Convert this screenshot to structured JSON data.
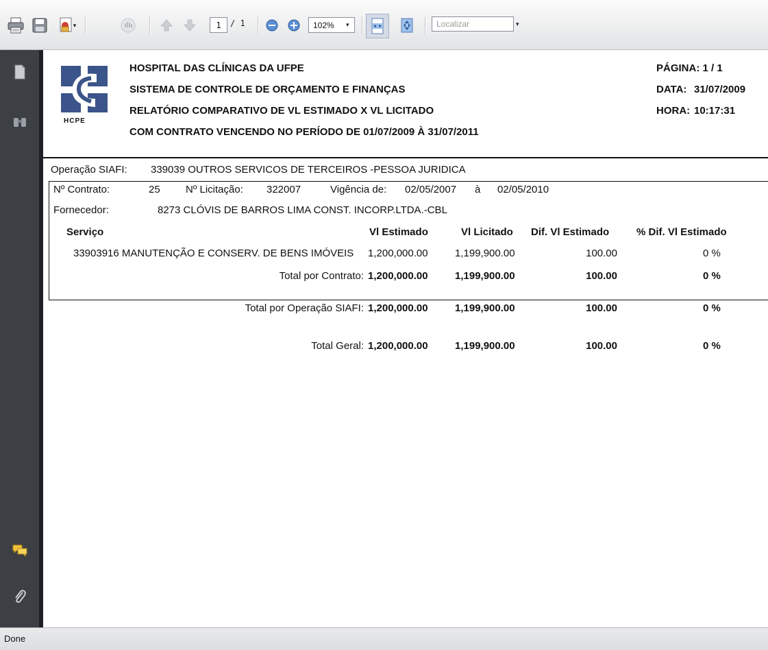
{
  "toolbar": {
    "icons": [
      "printer-icon",
      "save-icon",
      "email-icon",
      "hand-icon",
      "previous-page-icon",
      "next-page-icon",
      "zoom-out-icon",
      "zoom-in-icon",
      "fit-width-icon",
      "fit-page-icon"
    ],
    "page_current": "1",
    "page_total": "/ 1",
    "zoom": "102%",
    "find_placeholder": "Localizar"
  },
  "sidebar": {
    "icons": [
      "pages-icon",
      "search-icon",
      "comments-icon",
      "attachments-icon"
    ]
  },
  "report": {
    "logo_text": "HCPE",
    "header_lines": [
      "HOSPITAL DAS CLÍNICAS DA UFPE",
      "SISTEMA DE CONTROLE DE ORÇAMENTO E FINANÇAS",
      "RELATÓRIO COMPARATIVO DE VL ESTIMADO X VL LICITADO",
      "COM CONTRATO VENCENDO NO PERÍODO DE 01/07/2009 À 31/07/2011"
    ],
    "page_label": "PÁGINA: 1 / 1",
    "date_label": "DATA:",
    "date_value": "31/07/2009",
    "time_label": "HORA:",
    "time_value": "10:17:31",
    "operacao_label": "Operação SIAFI:",
    "operacao_value": "339039  OUTROS SERVICOS DE TERCEIROS -PESSOA JURIDICA",
    "contrato_label": "Nº Contrato:",
    "contrato_value": "25",
    "licitacao_label": "Nº Licitação:",
    "licitacao_value": "322007",
    "vigencia_label": "Vigência de:",
    "vigencia_start": "02/05/2007",
    "vigencia_sep": "à",
    "vigencia_end": "02/05/2010",
    "fornecedor_label": "Fornecedor:",
    "fornecedor_value": "8273  CLÓVIS DE BARROS LIMA CONST. INCORP.LTDA.-CBL",
    "columns": [
      "Serviço",
      "Vl Estimado",
      "Vl Licitado",
      "Dif. Vl Estimado",
      "% Dif. Vl Estimado"
    ],
    "row": {
      "servico": "33903916  MANUTENÇÃO E CONSERV. DE BENS IMÓVEIS",
      "estimado": "1,200,000.00",
      "licitado": "1,199,900.00",
      "dif": "100.00",
      "pct": "0  %"
    },
    "totals": [
      {
        "label": "Total por Contrato:",
        "estimado": "1,200,000.00",
        "licitado": "1,199,900.00",
        "dif": "100.00",
        "pct": "0  %"
      },
      {
        "label": "Total por Operação SIAFI:",
        "estimado": "1,200,000.00",
        "licitado": "1,199,900.00",
        "dif": "100.00",
        "pct": "0  %"
      },
      {
        "label": "Total Geral:",
        "estimado": "1,200,000.00",
        "licitado": "1,199,900.00",
        "dif": "100.00",
        "pct": "0  %"
      }
    ]
  },
  "status": {
    "text": "Done"
  }
}
